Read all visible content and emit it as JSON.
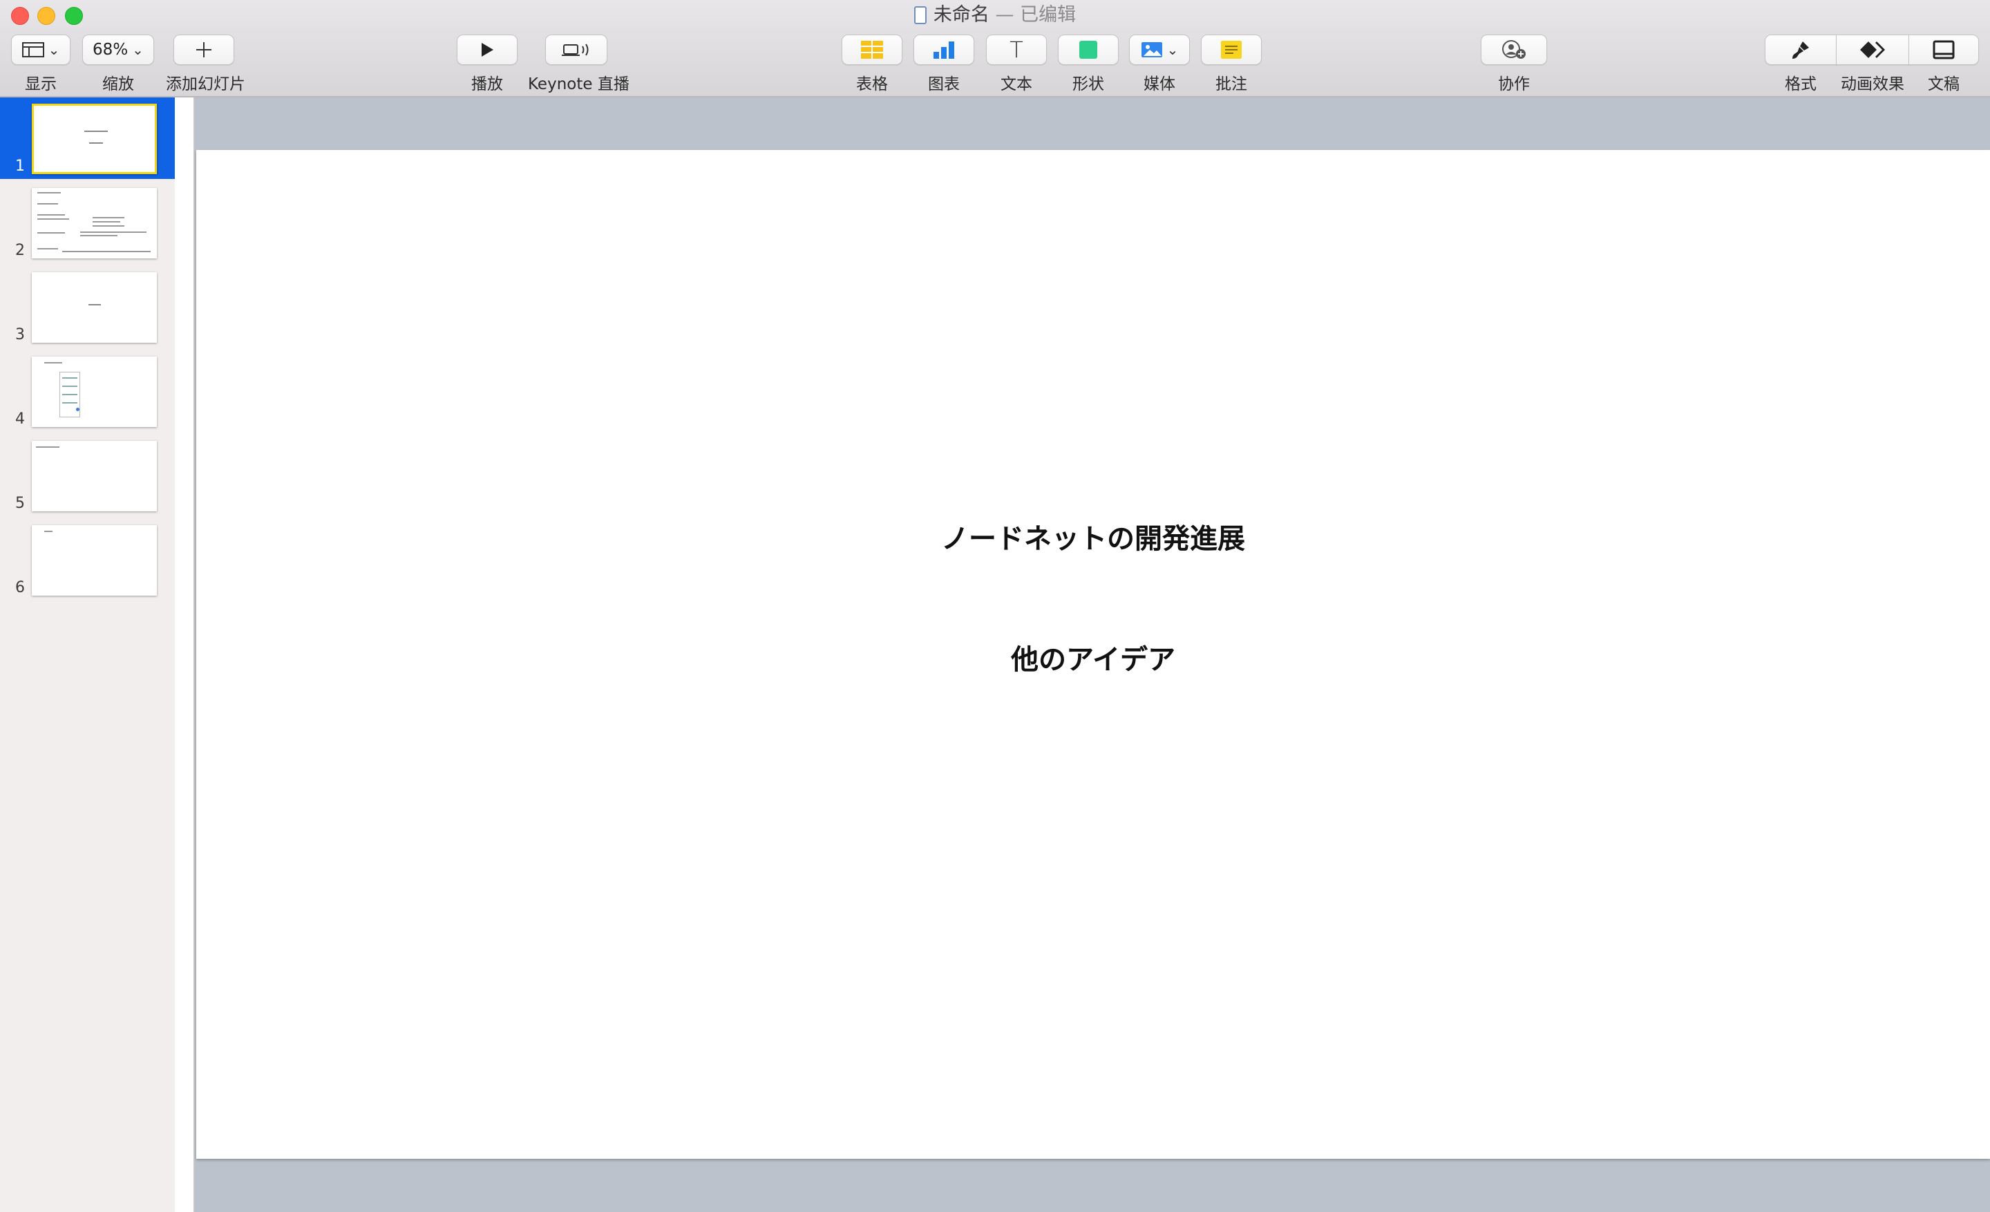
{
  "window": {
    "title": "未命名",
    "edited": "— 已编辑"
  },
  "toolbar": {
    "view": {
      "label": "显示",
      "icon": "sidebar-layout-icon"
    },
    "zoom": {
      "label": "缩放",
      "value": "68%"
    },
    "add_slide": {
      "label": "添加幻灯片",
      "icon": "plus-icon"
    },
    "play": {
      "label": "播放",
      "icon": "play-icon"
    },
    "keynote_live": {
      "label": "Keynote 直播",
      "icon": "broadcast-icon"
    },
    "table": {
      "label": "表格",
      "icon": "table-icon"
    },
    "chart": {
      "label": "图表",
      "icon": "bar-chart-icon"
    },
    "text": {
      "label": "文本",
      "icon": "text-icon",
      "glyph": "T"
    },
    "shape": {
      "label": "形状",
      "icon": "square-icon"
    },
    "media": {
      "label": "媒体",
      "icon": "photo-icon"
    },
    "comment": {
      "label": "批注",
      "icon": "note-icon"
    },
    "collaborate": {
      "label": "协作",
      "icon": "add-person-icon"
    },
    "format": {
      "label": "格式",
      "icon": "paintbrush-icon"
    },
    "animate": {
      "label": "动画效果",
      "icon": "diamond-icon"
    },
    "document": {
      "label": "文稿",
      "icon": "document-icon"
    }
  },
  "navigator": {
    "slides": [
      {
        "number": "1",
        "selected": true
      },
      {
        "number": "2",
        "selected": false
      },
      {
        "number": "3",
        "selected": false
      },
      {
        "number": "4",
        "selected": false
      },
      {
        "number": "5",
        "selected": false
      },
      {
        "number": "6",
        "selected": false
      }
    ]
  },
  "slide": {
    "title": "ノードネットの開発進展",
    "subtitle": "他のアイデア"
  },
  "colors": {
    "selection": "#0f63e4",
    "thumb_highlight": "#f2d516",
    "canvas_bg": "#bcc2cb"
  }
}
